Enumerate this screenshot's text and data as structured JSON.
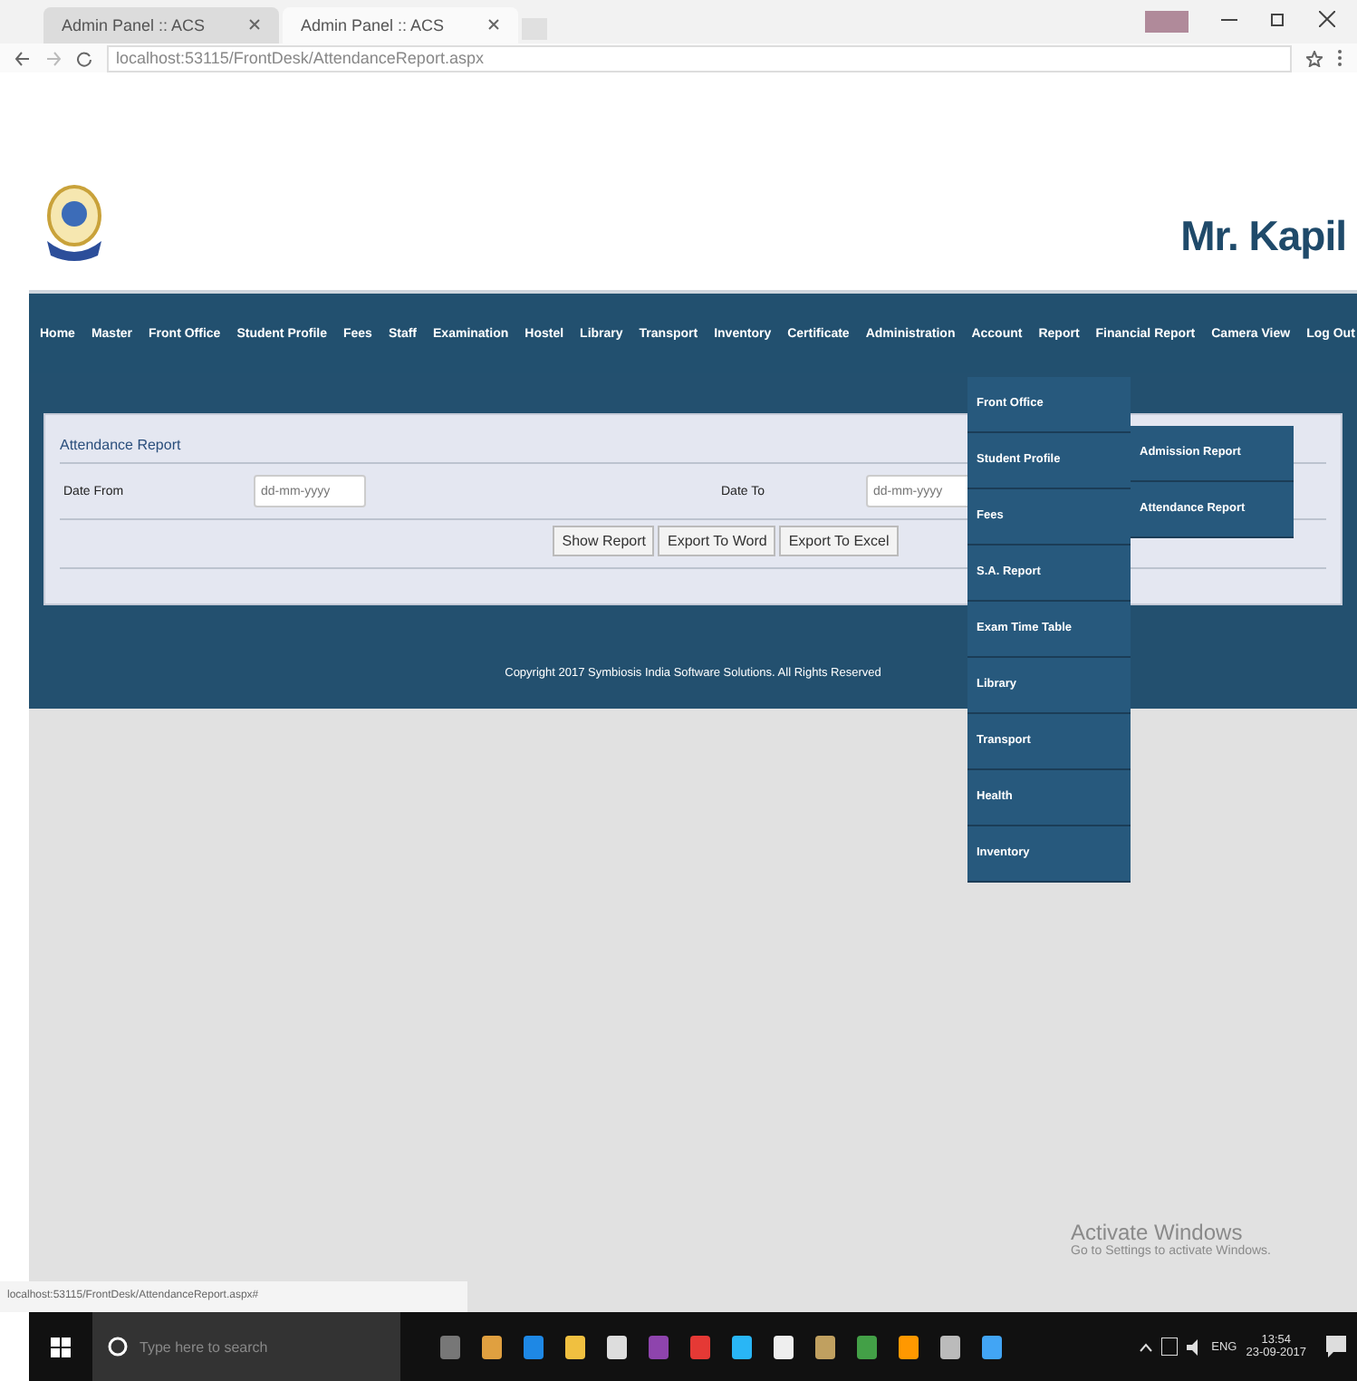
{
  "browser": {
    "tabs": [
      {
        "title": "Admin Panel :: ACS",
        "selected": false
      },
      {
        "title": "Admin Panel :: ACS",
        "selected": true
      }
    ],
    "url": "localhost:53115/FrontDesk/AttendanceReport.aspx"
  },
  "header": {
    "user": "Mr. Kapil"
  },
  "nav": {
    "items": [
      "Home",
      "Master",
      "Front Office",
      "Student Profile",
      "Fees",
      "Staff",
      "Examination",
      "Hostel",
      "Library",
      "Transport",
      "Inventory",
      "Certificate",
      "Administration",
      "Account",
      "Report",
      "Financial Report",
      "Camera View",
      "Log Out"
    ]
  },
  "dropdown": {
    "items": [
      "Front Office",
      "Student Profile",
      "Fees",
      "S.A. Report",
      "Exam Time Table",
      "Library",
      "Transport",
      "Health",
      "Inventory"
    ]
  },
  "submenu": {
    "items": [
      "Admission Report",
      "Attendance Report"
    ]
  },
  "panel": {
    "title": "Attendance Report",
    "fields": [
      {
        "label": "Date From",
        "placeholder": "dd-mm-yyyy"
      },
      {
        "label": "Date To",
        "placeholder": "dd-mm-yyyy"
      }
    ],
    "buttons": [
      "Show Report",
      "Export To Word",
      "Export To Excel"
    ]
  },
  "footer": "Copyright 2017 Symbiosis India Software Solutions. All Rights Reserved",
  "status_url": "localhost:53115/FrontDesk/AttendanceReport.aspx#",
  "activation": {
    "title": "Activate Windows",
    "subtitle": "Go to Settings to activate Windows."
  },
  "taskbar": {
    "search_placeholder": "Type here to search",
    "language": "ENG",
    "time": "13:54",
    "date": "23-09-2017"
  }
}
